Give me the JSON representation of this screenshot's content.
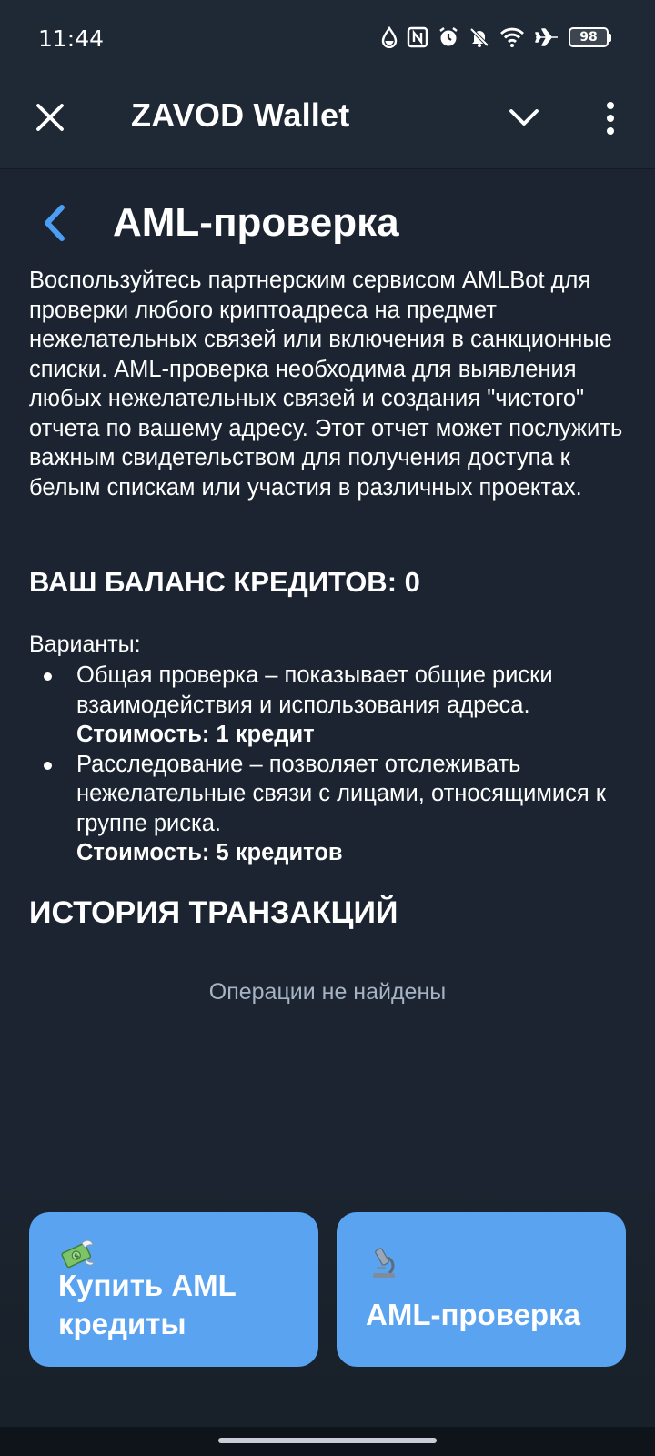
{
  "status_bar": {
    "time": "11:44",
    "battery": "98",
    "icons": [
      "water-drop-icon",
      "nfc-icon",
      "alarm-icon",
      "mute-icon",
      "wifi-icon",
      "airplane-icon",
      "battery-icon"
    ]
  },
  "header": {
    "title": "ZAVOD Wallet",
    "close_icon": "close-icon",
    "collapse_icon": "chevron-down-icon",
    "menu_icon": "more-vertical-icon"
  },
  "page": {
    "title": "AML-проверка",
    "back_icon": "back-arrow-icon",
    "description": "Воспользуйтесь партнерским сервисом AMLBot для проверки любого криптоадреса на предмет нежелательных связей или включения в санкционные списки. AML-проверка необходима для выявления любых нежелательных связей и создания \"чистого\" отчета по вашему адресу. Этот отчет может послужить важным свидетельством для получения доступа к белым спискам или участия в различных проектах.",
    "balance": "ВАШ БАЛАНС КРЕДИТОВ: 0",
    "options_label": "Варианты:",
    "options": [
      {
        "text": "Общая проверка – показывает общие риски взаимодействия и использования адреса.",
        "cost": "Стоимость: 1 кредит"
      },
      {
        "text": "Расследование – позволяет отслеживать нежелательные связи с лицами, относящимися к группе риска.",
        "cost": "Стоимость: 5 кредитов"
      }
    ],
    "history_title": "ИСТОРИЯ ТРАНЗАКЦИЙ",
    "empty_state": "Операции не найдены"
  },
  "actions": {
    "buy": {
      "label": "Купить AML кредиты",
      "icon": "money-wings-icon"
    },
    "check": {
      "label": "AML-проверка",
      "icon": "microscope-icon"
    }
  },
  "colors": {
    "background": "#1b2430",
    "header": "#1f2936",
    "accent": "#5aa3f0",
    "back_arrow": "#4a9ff5",
    "muted_text": "#a5b3c4"
  }
}
